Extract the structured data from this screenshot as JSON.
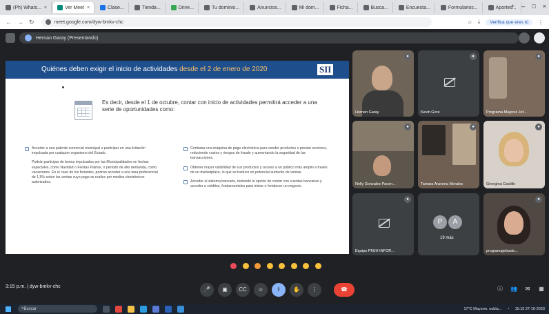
{
  "browser": {
    "tabs": [
      {
        "label": "(Ph) Whats..."
      },
      {
        "label": "Ver Meet"
      },
      {
        "label": "Clase..."
      },
      {
        "label": "Tienda..."
      },
      {
        "label": "Drive..."
      },
      {
        "label": "Tu dominio..."
      },
      {
        "label": "Anuncios..."
      },
      {
        "label": "Mi dom..."
      },
      {
        "label": "Ficha..."
      },
      {
        "label": "Busca..."
      },
      {
        "label": "Encuesta..."
      },
      {
        "label": "Formularios..."
      },
      {
        "label": "Aportes..."
      }
    ],
    "url": "meet.google.com/dyw-bmkv-chc",
    "profile": "Verifica que eres tú"
  },
  "meet": {
    "presenter_label": "Hernan Garay (Presentando)",
    "time": "3:15 p.m.",
    "meeting_code": "dyw-bmkv-chc",
    "others_count": "19 más",
    "others_initials": [
      "P",
      "A"
    ]
  },
  "slide": {
    "title": "Quiénes deben exigir el inicio de actividades",
    "title_sub": "desde el 2 de enero de 2020",
    "logo": "SII",
    "intro": "Es decir, desde el 1 de octubre, contar con inicio de actividades permitirá acceder a una serie de oportunidades como:",
    "left_col": [
      "Acceder a una patente comercial municipal o participar en una licitación impulsada por cualquier organismo del Estado.",
      "Podrán participar de bonos impulsados por las Municipalidades en fechas especiales, como Navidad o Fiestas Patrias, o período de alto demanda, como vacaciones. En el caso de los feriantes, podrán acceder a una tasa preferencial de 1,5% sobre las ventas cuyo pago se realice por medios electrónicos autorizados."
    ],
    "right_col": [
      "Contratar una máquina de pago electrónica para vender productos o prestar servicios, reduciendo costos y riesgos de fraude y aumentando la seguridad de las transacciones.",
      "Obtener mayor visibilidad de sus productos y acceso a un público más amplio a través de un marketplace, lo que se traduce en potencial aumento de ventas.",
      "Acceder al sistema bancario, teniendo la opción de contar con cuentas bancarias y acceder a créditos, fundamentales para iniciar o fortalecer un negocio."
    ]
  },
  "participants": [
    {
      "name": "Hernan Garay"
    },
    {
      "name": "Kevin Gore"
    },
    {
      "name": "Programa Mujeres Jef..."
    },
    {
      "name": "Nelly Gonzalez Pacen..."
    },
    {
      "name": "Tamara Aravena Morales"
    },
    {
      "name": "Georgina Castillo"
    },
    {
      "name": "Equipo PMJH INFOR..."
    },
    {
      "name": "programajefasde..."
    }
  ],
  "taskbar": {
    "search": "Buscar",
    "weather": "17°C Mayorm. nubla...",
    "clock": "15:15 27-10-2023"
  }
}
